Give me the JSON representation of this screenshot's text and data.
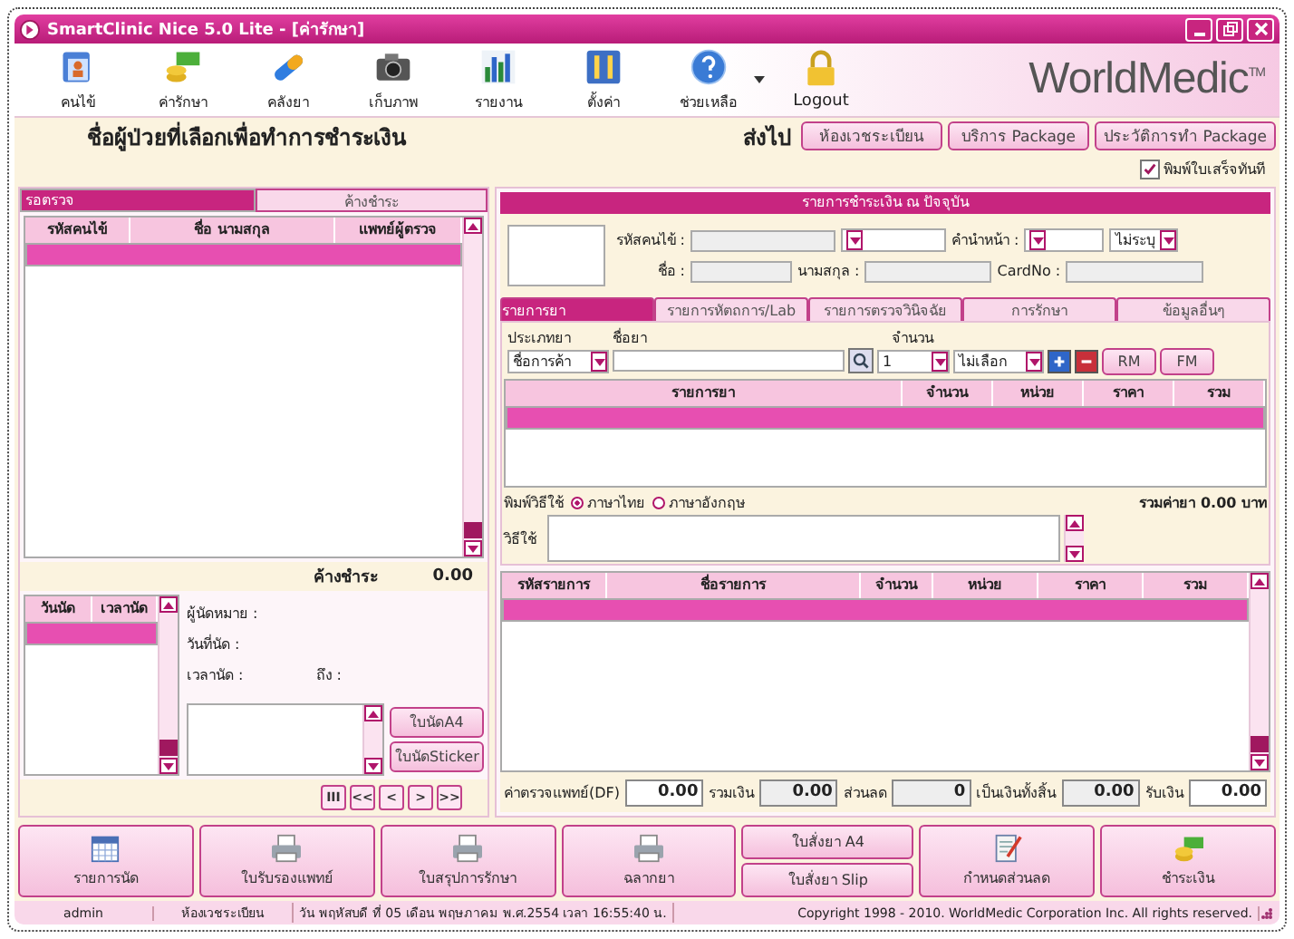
{
  "window": {
    "title": "SmartClinic Nice 5.0 Lite - [ค่ารักษา]"
  },
  "toolbar": [
    {
      "label": "คนไข้"
    },
    {
      "label": "ค่ารักษา"
    },
    {
      "label": "คลังยา"
    },
    {
      "label": "เก็บภาพ"
    },
    {
      "label": "รายงาน"
    },
    {
      "label": "ตั้งค่า"
    },
    {
      "label": "ช่วยเหลือ",
      "dropdown": true
    },
    {
      "label": "Logout"
    }
  ],
  "logo": "WorldMedic$^{TM}$",
  "header": {
    "title": "ชื่อผู้ป่วยที่เลือกเพื่อทำการชำระเงิน",
    "send_label": "ส่งไป",
    "buttons": [
      "ห้องเวชระเบียน",
      "บริการ Package",
      "ประวัติการทำ Package"
    ]
  },
  "print_receipt": {
    "label": "พิมพ์ใบเสร็จทันที",
    "checked": true
  },
  "queue": {
    "tabs": [
      {
        "label": "รอตรวจ",
        "selected": true
      },
      {
        "label": "ค้างชำระ",
        "selected": false
      }
    ],
    "columns": [
      "รหัสคนไข้",
      "ชื่อ นามสกุล",
      "แพทย์ผู้ตรวจ"
    ],
    "rows": [
      {
        "selected": true
      }
    ],
    "total_label": "ค้างชำระ",
    "total": "0.00"
  },
  "appointments": {
    "columns": [
      "วันนัด",
      "เวลานัด"
    ],
    "rows": [
      {
        "selected": true
      }
    ],
    "fields": [
      "ผู้นัดหมาย :",
      "วันที่นัด :",
      "เวลานัด :"
    ],
    "to_label": "ถึง :",
    "buttons": [
      "ใบนัดA4",
      "ใบนัดSticker"
    ]
  },
  "pager": [
    "III",
    "<<",
    "<",
    ">",
    ">>"
  ],
  "payment": {
    "title": "รายการชำระเงิน ณ ปัจจุบัน",
    "labels": {
      "hn": "รหัสคนไข้ :",
      "prefix": "คำนำหน้า :",
      "first": "ชื่อ :",
      "last": "นามสกุล :",
      "card": "CardNo :"
    },
    "gender": "ไม่ระบุ",
    "tabs": [
      {
        "label": "รายการยา",
        "selected": true
      },
      {
        "label": "รายการหัตถการ/Lab",
        "selected": false
      },
      {
        "label": "รายการตรวจวินิจฉัย",
        "selected": false
      },
      {
        "label": "การรักษา",
        "selected": false
      },
      {
        "label": "ข้อมูลอื่นๆ",
        "selected": false
      }
    ],
    "drug_entry": {
      "type_label": "ประเภทยา",
      "type_value": "ชื่อการค้า",
      "name_label": "ชื่อยา",
      "qty_label": "จำนวน",
      "qty_value": "1",
      "option_value": "ไม่เลือก",
      "buttons": [
        "RM",
        "FM"
      ]
    },
    "drug_table": {
      "columns": [
        "รายการยา",
        "จำนวน",
        "หน่วย",
        "ราคา",
        "รวม"
      ],
      "rows": [
        {
          "selected": true
        }
      ]
    },
    "instructions": {
      "label": "พิมพ์วิธีใช้",
      "languages": [
        {
          "label": "ภาษาไทย",
          "selected": true
        },
        {
          "label": "ภาษาอังกฤษ",
          "selected": false
        }
      ],
      "total": "รวมค่ายา 0.00 บาท",
      "usage_label": "วิธีใช้"
    },
    "items_table": {
      "columns": [
        "รหัสรายการ",
        "ชื่อรายการ",
        "จำนวน",
        "หน่วย",
        "ราคา",
        "รวม"
      ],
      "rows": [
        {
          "selected": true
        }
      ]
    },
    "totals": [
      {
        "label": "ค่าตรวจแพทย์(DF)",
        "value": "0.00",
        "editable": true
      },
      {
        "label": "รวมเงิน",
        "value": "0.00",
        "editable": false
      },
      {
        "label": "ส่วนลด",
        "value": "0",
        "editable": false
      },
      {
        "label": "เป็นเงินทั้งสิ้น",
        "value": "0.00",
        "editable": false
      },
      {
        "label": "รับเงิน",
        "value": "0.00",
        "editable": true
      }
    ]
  },
  "actions": [
    {
      "kind": "single",
      "labels": [
        "รายการนัด"
      ]
    },
    {
      "kind": "single",
      "labels": [
        "ใบรับรองแพทย์"
      ]
    },
    {
      "kind": "single",
      "labels": [
        "ใบสรุปการรักษา"
      ]
    },
    {
      "kind": "single",
      "labels": [
        "ฉลากยา"
      ]
    },
    {
      "kind": "stack",
      "labels": [
        "ใบสั่งยา A4",
        "ใบสั่งยา Slip"
      ]
    },
    {
      "kind": "single",
      "labels": [
        "กำหนดส่วนลด"
      ]
    },
    {
      "kind": "single",
      "labels": [
        "ชำระเงิน"
      ]
    }
  ],
  "status_bar": [
    "admin",
    "ห้องเวชระเบียน",
    "วัน พฤหัสบดี ที่ 05 เดือน พฤษภาคม พ.ศ.2554 เวลา 16:55:40 น.",
    "Copyright 1998 - 2010. WorldMedic Corporation Inc. All rights reserved."
  ]
}
